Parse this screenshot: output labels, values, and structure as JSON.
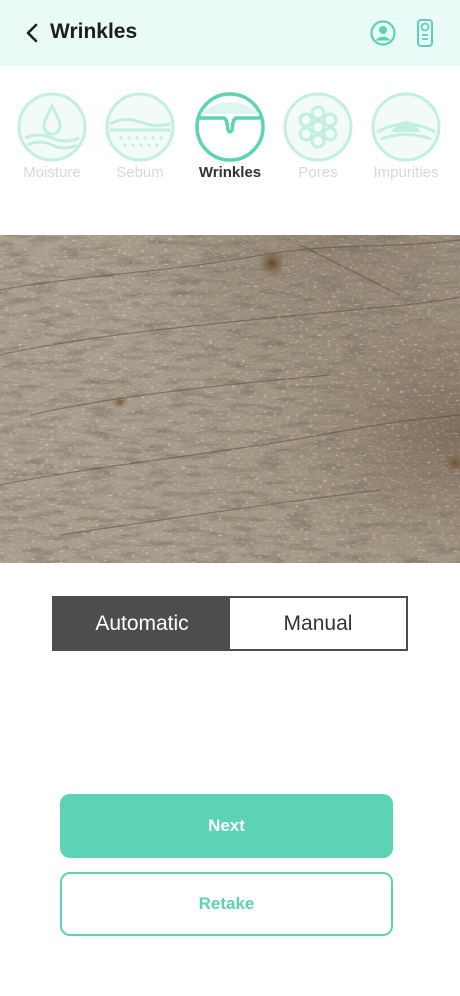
{
  "colors": {
    "accent": "#5cd3b4",
    "header_bg": "#eafaf6",
    "segment_dark": "#4d4d4d",
    "inactive_label": "#d8d8d8"
  },
  "header": {
    "title": "Wrinkles",
    "back_icon": "chevron-left-icon",
    "profile_icon": "user-circle-icon",
    "device_icon": "device-icon"
  },
  "categories": [
    {
      "label": "Moisture",
      "icon": "water-drop-icon",
      "active": false
    },
    {
      "label": "Sebum",
      "icon": "sebum-icon",
      "active": false
    },
    {
      "label": "Wrinkles",
      "icon": "wrinkle-icon",
      "active": true
    },
    {
      "label": "Pores",
      "icon": "pores-icon",
      "active": false
    },
    {
      "label": "Impurities",
      "icon": "impurities-icon",
      "active": false
    }
  ],
  "mode": {
    "options": [
      "Automatic",
      "Manual"
    ],
    "selected": "Automatic"
  },
  "buttons": {
    "next": "Next",
    "retake": "Retake"
  }
}
